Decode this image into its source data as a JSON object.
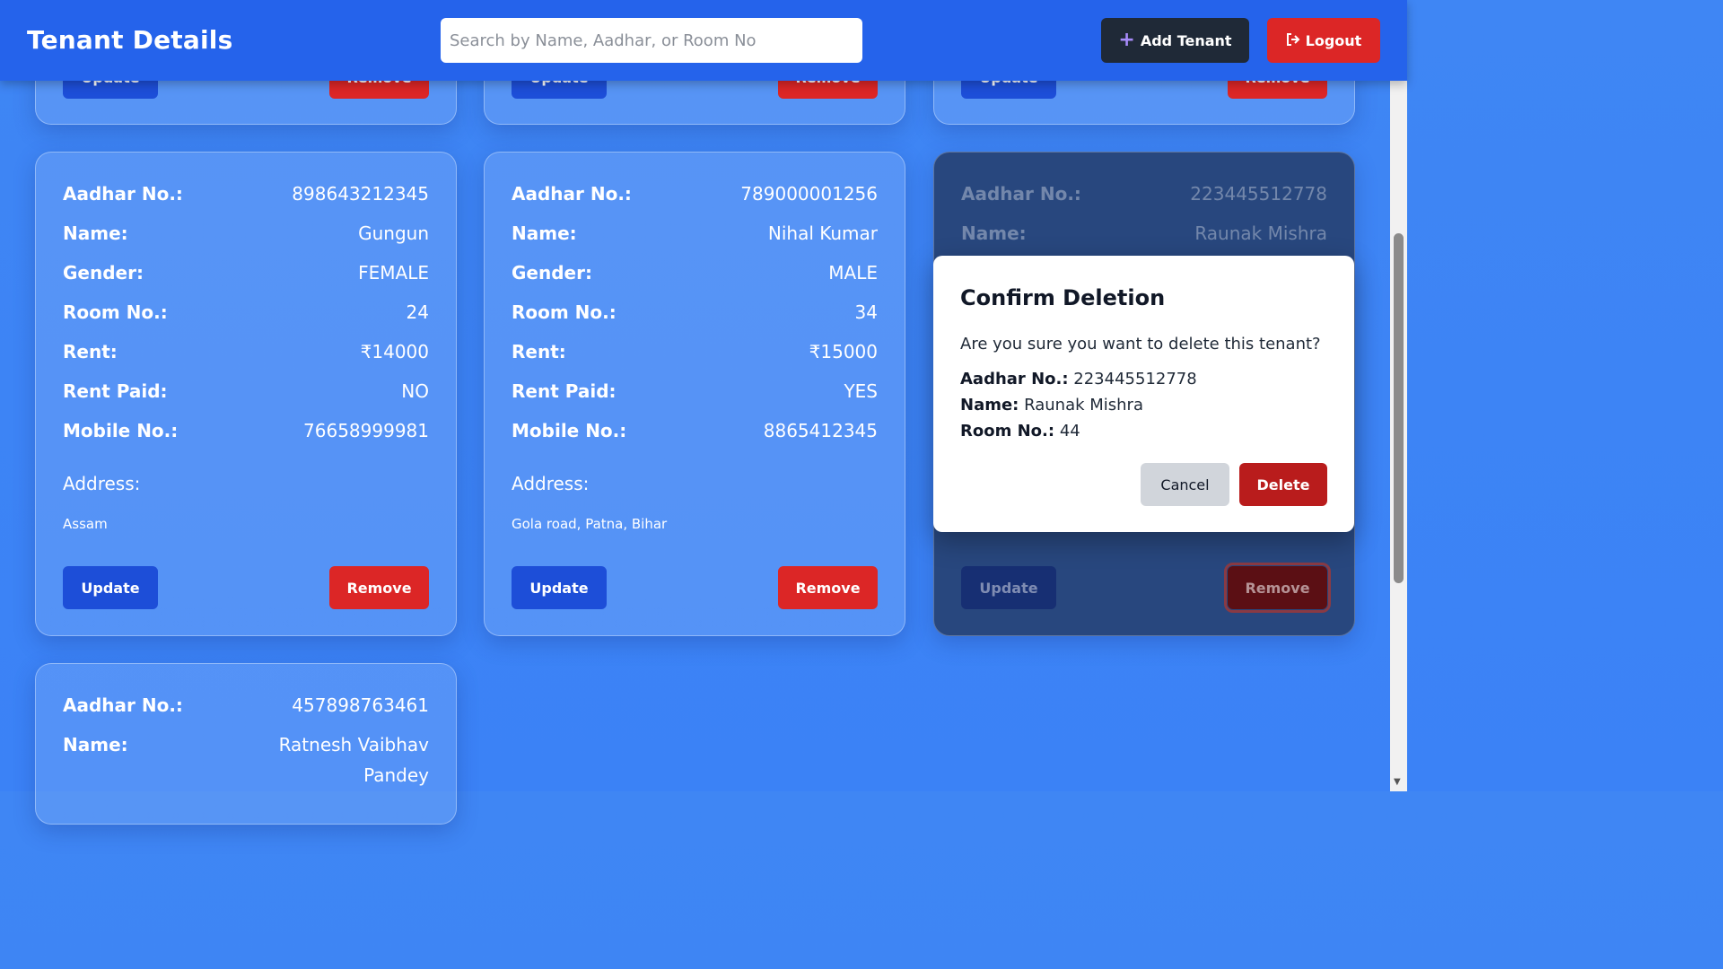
{
  "header": {
    "title": "Tenant Details",
    "search_placeholder": "Search by Name, Aadhar, or Room No",
    "add_label": "Add Tenant",
    "logout_label": "Logout"
  },
  "labels": {
    "aadhar": "Aadhar No.:",
    "name": "Name:",
    "gender": "Gender:",
    "room": "Room No.:",
    "rent": "Rent:",
    "rent_paid": "Rent Paid:",
    "mobile": "Mobile No.:",
    "address": "Address:",
    "update": "Update",
    "remove": "Remove"
  },
  "tenants": [
    {
      "aadhar": "898643212345",
      "name": "Gungun",
      "gender": "FEMALE",
      "room": "24",
      "rent": "₹14000",
      "rent_paid": "NO",
      "mobile": "76658999981",
      "address": "Assam"
    },
    {
      "aadhar": "789000001256",
      "name": "Nihal Kumar",
      "gender": "MALE",
      "room": "34",
      "rent": "₹15000",
      "rent_paid": "YES",
      "mobile": "8865412345",
      "address": "Gola road, Patna, Bihar"
    },
    {
      "aadhar": "223445512778",
      "name": "Raunak Mishra"
    },
    {
      "aadhar": "457898763461",
      "name": "Ratnesh Vaibhav",
      "name_cont": "Pandey"
    }
  ],
  "modal": {
    "title": "Confirm Deletion",
    "question": "Are you sure you want to delete this tenant?",
    "aadhar_label": "Aadhar No.:",
    "aadhar_value": "223445512778",
    "name_label": "Name:",
    "name_value": "Raunak Mishra",
    "room_label": "Room No.:",
    "room_value": "44",
    "cancel_label": "Cancel",
    "delete_label": "Delete"
  },
  "icons": {
    "add": "plus-icon",
    "logout": "sign-out-icon"
  }
}
